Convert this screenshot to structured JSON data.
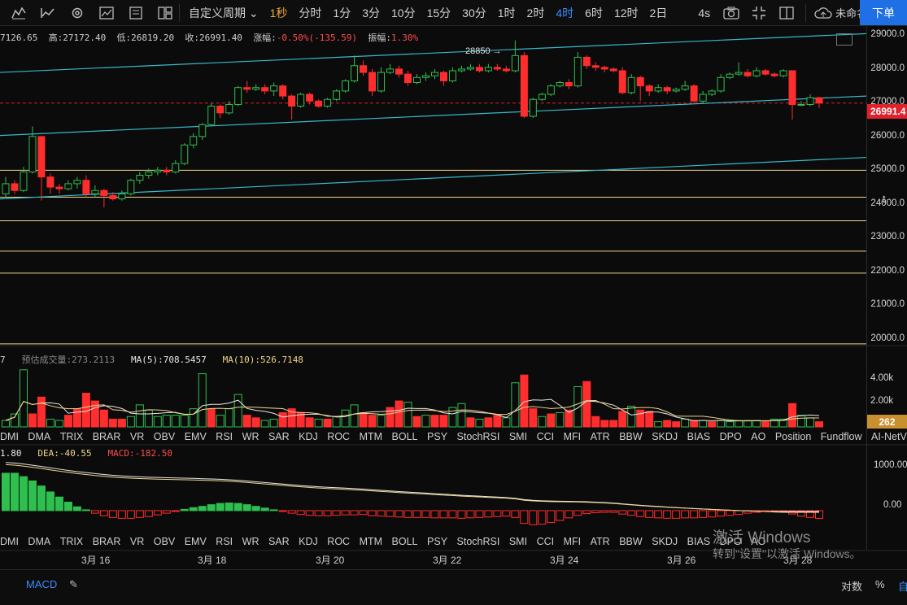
{
  "toolbar": {
    "period_label": "自定义周期",
    "intervals": [
      {
        "label": "1秒",
        "active": true
      },
      {
        "label": "分时"
      },
      {
        "label": "1分"
      },
      {
        "label": "3分"
      },
      {
        "label": "10分"
      },
      {
        "label": "15分"
      },
      {
        "label": "30分"
      },
      {
        "label": "1时"
      },
      {
        "label": "2时"
      },
      {
        "label": "4时",
        "blue": true
      },
      {
        "label": "6时"
      },
      {
        "label": "12时"
      },
      {
        "label": "2日"
      }
    ],
    "refresh": "4s",
    "cloud_name": "未命名",
    "order_button": "下单"
  },
  "info": {
    "open": "7126.65",
    "high_label": "高:",
    "high": "27172.40",
    "low_label": "低:",
    "low": "26819.20",
    "close_label": "收:",
    "close": "26991.40",
    "change_label": "涨幅:",
    "change": "-0.50%(-135.59)",
    "amp_label": "振幅:",
    "amp": "1.30%"
  },
  "annotation_high": "28850",
  "price_axis": [
    "29000.0",
    "28000.0",
    "27000.0",
    "26000.0",
    "25000.0",
    "24000.0",
    "23000.0",
    "22000.0",
    "21000.0",
    "20000.0"
  ],
  "current_price": "26991.4",
  "volume": {
    "left_value": "7",
    "est_label": "预估成交量:",
    "est_value": "273.2113",
    "ma5_label": "MA(5):",
    "ma5_value": "708.5457",
    "ma10_label": "MA(10):",
    "ma10_value": "526.7148",
    "axis": [
      "4.00k",
      "2.00k"
    ],
    "current": "262"
  },
  "indicators": [
    "DMI",
    "DMA",
    "TRIX",
    "BRAR",
    "VR",
    "OBV",
    "EMV",
    "RSI",
    "WR",
    "SAR",
    "KDJ",
    "ROC",
    "MTM",
    "BOLL",
    "PSY",
    "StochRSI",
    "SMI",
    "CCI",
    "MFI",
    "ATR",
    "BBW",
    "SKDJ",
    "BIAS",
    "DPO",
    "AO",
    "Position",
    "Fundflow",
    "AI-NetVOL"
  ],
  "macd": {
    "dif": "1.80",
    "dea_label": "DEA:",
    "dea": "-40.55",
    "macd_label": "MACD:",
    "macd": "-182.50",
    "axis": [
      "1000.00",
      "0.00"
    ]
  },
  "dates": [
    "3月 16",
    "3月 18",
    "3月 20",
    "3月 22",
    "3月 24",
    "3月 26",
    "3月 28"
  ],
  "bottom": {
    "macd_tab": "MACD",
    "log_label": "对数",
    "pct_label": "%",
    "auto_label": "自"
  },
  "watermark": {
    "line1": "激活 Windows",
    "line2": "转到\"设置\"以激活 Windows。"
  },
  "colors": {
    "up": "#2fbf4f",
    "down": "#ff2d2d",
    "channel": "#38b8c8",
    "level": "#f1d58c",
    "accent": "#f2a93b",
    "order": "#1f6fe5"
  },
  "chart_data": {
    "type": "candlestick",
    "ylim": [
      19800,
      29300
    ],
    "levels": [
      25000,
      24200,
      23500,
      22600,
      21950,
      19850
    ],
    "channel_lines": [
      {
        "from": [
          0,
          27900
        ],
        "to": [
          1065,
          29050
        ]
      },
      {
        "from": [
          0,
          26030
        ],
        "to": [
          1065,
          27200
        ]
      },
      {
        "from": [
          0,
          24150
        ],
        "to": [
          1065,
          25380
        ]
      }
    ],
    "candles": [
      [
        24300,
        24600,
        24200,
        24800
      ],
      [
        24600,
        24400,
        24300,
        24700
      ],
      [
        24400,
        24950,
        24350,
        25100
      ],
      [
        24950,
        26000,
        24900,
        26300
      ],
      [
        26000,
        24800,
        24100,
        25900
      ],
      [
        24800,
        24500,
        24300,
        24900
      ],
      [
        24500,
        24450,
        24300,
        24600
      ],
      [
        24450,
        24600,
        24400,
        24700
      ],
      [
        24600,
        24700,
        24450,
        24800
      ],
      [
        24700,
        24300,
        24200,
        24850
      ],
      [
        24300,
        24400,
        24200,
        24550
      ],
      [
        24400,
        24250,
        23900,
        24450
      ],
      [
        24250,
        24150,
        24100,
        24350
      ],
      [
        24150,
        24300,
        24100,
        24400
      ],
      [
        24300,
        24700,
        24250,
        24750
      ],
      [
        24700,
        24850,
        24600,
        24950
      ],
      [
        24850,
        24950,
        24750,
        25050
      ],
      [
        24950,
        25000,
        24850,
        25100
      ],
      [
        25000,
        24950,
        24850,
        25100
      ],
      [
        24950,
        25200,
        24900,
        25300
      ],
      [
        25200,
        25750,
        25150,
        25800
      ],
      [
        25750,
        26000,
        25650,
        26100
      ],
      [
        26000,
        26350,
        25900,
        26400
      ],
      [
        26350,
        26900,
        26300,
        27000
      ],
      [
        26900,
        26700,
        26550,
        26950
      ],
      [
        26700,
        26950,
        26650,
        27050
      ],
      [
        26950,
        27450,
        26900,
        27500
      ],
      [
        27450,
        27400,
        27300,
        27650
      ],
      [
        27400,
        27450,
        27350,
        27550
      ],
      [
        27450,
        27350,
        27250,
        27550
      ],
      [
        27350,
        27500,
        27200,
        27600
      ],
      [
        27500,
        27200,
        27100,
        27550
      ],
      [
        27200,
        26900,
        26500,
        27250
      ],
      [
        26900,
        27250,
        26850,
        27300
      ],
      [
        27250,
        27050,
        26950,
        27300
      ],
      [
        27050,
        26900,
        26850,
        27100
      ],
      [
        26900,
        27100,
        26850,
        27150
      ],
      [
        27100,
        27350,
        27050,
        27400
      ],
      [
        27350,
        27650,
        27300,
        27700
      ],
      [
        27650,
        28100,
        27600,
        28400
      ],
      [
        28100,
        27900,
        27800,
        28250
      ],
      [
        27900,
        27350,
        27200,
        28000
      ],
      [
        27350,
        27900,
        27300,
        28050
      ],
      [
        27900,
        28000,
        27850,
        28150
      ],
      [
        28000,
        27850,
        27750,
        28100
      ],
      [
        27850,
        27600,
        27500,
        27950
      ],
      [
        27600,
        27750,
        27550,
        27850
      ],
      [
        27750,
        27800,
        27650,
        27900
      ],
      [
        27800,
        27900,
        27700,
        28000
      ],
      [
        27900,
        27650,
        27500,
        27950
      ],
      [
        27650,
        27950,
        27600,
        28050
      ],
      [
        27950,
        28000,
        27900,
        28100
      ],
      [
        28000,
        28050,
        27950,
        28150
      ],
      [
        28050,
        27950,
        27900,
        28150
      ],
      [
        27950,
        28050,
        27900,
        28150
      ],
      [
        28050,
        28000,
        27950,
        28150
      ],
      [
        28000,
        27950,
        27900,
        28100
      ],
      [
        27950,
        28400,
        27900,
        28850
      ],
      [
        28400,
        26600,
        26550,
        28500
      ],
      [
        26600,
        27100,
        26550,
        27150
      ],
      [
        27100,
        27250,
        27050,
        27300
      ],
      [
        27250,
        27500,
        27200,
        27550
      ],
      [
        27500,
        27600,
        27450,
        27650
      ],
      [
        27600,
        27500,
        27400,
        27700
      ],
      [
        27500,
        28350,
        27450,
        28500
      ],
      [
        28350,
        28100,
        28000,
        28400
      ],
      [
        28100,
        28050,
        27950,
        28200
      ],
      [
        28050,
        28000,
        27900,
        28100
      ],
      [
        28000,
        27950,
        27900,
        28050
      ],
      [
        27950,
        27300,
        27250,
        28050
      ],
      [
        27300,
        27750,
        27250,
        27850
      ],
      [
        27750,
        27500,
        27050,
        27800
      ],
      [
        27500,
        27350,
        27200,
        27550
      ],
      [
        27350,
        27450,
        27300,
        27550
      ],
      [
        27450,
        27350,
        27250,
        27500
      ],
      [
        27350,
        27400,
        27300,
        27450
      ],
      [
        27400,
        27500,
        27350,
        27650
      ],
      [
        27500,
        27050,
        27000,
        27550
      ],
      [
        27050,
        27250,
        27000,
        27350
      ],
      [
        27250,
        27350,
        27200,
        27400
      ],
      [
        27350,
        27750,
        27300,
        27850
      ],
      [
        27750,
        27850,
        27700,
        27900
      ],
      [
        27850,
        27900,
        27800,
        28200
      ],
      [
        27900,
        27800,
        27750,
        28000
      ],
      [
        27800,
        27950,
        27750,
        28050
      ],
      [
        27950,
        27850,
        27800,
        28000
      ],
      [
        27850,
        27800,
        27750,
        27900
      ],
      [
        27800,
        27950,
        27750,
        28000
      ],
      [
        27950,
        26950,
        26500,
        27950
      ],
      [
        26950,
        26950,
        26900,
        27050
      ],
      [
        26950,
        27150,
        26900,
        27250
      ],
      [
        27150,
        26990,
        26850,
        27172
      ]
    ],
    "volumes": [
      [
        0.5,
        1
      ],
      [
        1.0,
        1
      ],
      [
        4.4,
        1
      ],
      [
        1.0,
        0
      ],
      [
        2.3,
        0
      ],
      [
        0.6,
        1
      ],
      [
        0.5,
        1
      ],
      [
        0.9,
        0
      ],
      [
        1.4,
        0
      ],
      [
        2.6,
        0
      ],
      [
        2.0,
        0
      ],
      [
        1.3,
        0
      ],
      [
        0.6,
        0
      ],
      [
        0.6,
        0
      ],
      [
        0.8,
        1
      ],
      [
        1.7,
        1
      ],
      [
        1.3,
        1
      ],
      [
        0.8,
        1
      ],
      [
        0.9,
        1
      ],
      [
        0.9,
        1
      ],
      [
        0.9,
        1
      ],
      [
        1.4,
        1
      ],
      [
        4.1,
        1
      ],
      [
        1.4,
        0
      ],
      [
        0.9,
        1
      ],
      [
        1.4,
        1
      ],
      [
        2.5,
        1
      ],
      [
        0.9,
        0
      ],
      [
        0.7,
        0
      ],
      [
        0.5,
        1
      ],
      [
        0.6,
        1
      ],
      [
        1.1,
        0
      ],
      [
        1.4,
        0
      ],
      [
        1.1,
        0
      ],
      [
        0.7,
        0
      ],
      [
        0.6,
        1
      ],
      [
        0.6,
        0
      ],
      [
        0.8,
        1
      ],
      [
        1.3,
        1
      ],
      [
        1.7,
        1
      ],
      [
        1.1,
        0
      ],
      [
        0.9,
        0
      ],
      [
        0.9,
        1
      ],
      [
        1.5,
        0
      ],
      [
        2.0,
        0
      ],
      [
        1.9,
        1
      ],
      [
        0.8,
        0
      ],
      [
        0.9,
        1
      ],
      [
        0.9,
        0
      ],
      [
        0.9,
        0
      ],
      [
        1.5,
        1
      ],
      [
        1.8,
        1
      ],
      [
        0.7,
        0
      ],
      [
        0.6,
        1
      ],
      [
        0.7,
        0
      ],
      [
        0.9,
        0
      ],
      [
        0.7,
        1
      ],
      [
        3.4,
        1
      ],
      [
        4.0,
        0
      ],
      [
        1.4,
        0
      ],
      [
        0.8,
        1
      ],
      [
        1.0,
        0
      ],
      [
        1.1,
        1
      ],
      [
        1.3,
        0
      ],
      [
        3.1,
        1
      ],
      [
        3.5,
        0
      ],
      [
        0.8,
        0
      ],
      [
        0.5,
        0
      ],
      [
        0.5,
        0
      ],
      [
        1.2,
        0
      ],
      [
        1.6,
        1
      ],
      [
        1.3,
        0
      ],
      [
        1.2,
        0
      ],
      [
        0.4,
        1
      ],
      [
        0.5,
        0
      ],
      [
        0.4,
        0
      ],
      [
        0.6,
        1
      ],
      [
        0.5,
        0
      ],
      [
        0.5,
        1
      ],
      [
        0.4,
        0
      ],
      [
        0.5,
        1
      ],
      [
        0.4,
        1
      ],
      [
        0.5,
        1
      ],
      [
        0.5,
        1
      ],
      [
        0.5,
        1
      ],
      [
        0.4,
        0
      ],
      [
        0.6,
        1
      ],
      [
        0.6,
        1
      ],
      [
        1.8,
        0
      ],
      [
        0.9,
        1
      ],
      [
        0.7,
        1
      ],
      [
        0.4,
        0
      ]
    ],
    "macd_hist": [
      [
        880
      ],
      [
        880
      ],
      [
        800
      ],
      [
        700
      ],
      [
        580
      ],
      [
        440
      ],
      [
        320
      ],
      [
        200
      ],
      [
        90
      ],
      [
        20
      ],
      [
        -60
      ],
      [
        -120
      ],
      [
        -160
      ],
      [
        -180
      ],
      [
        -180
      ],
      [
        -160
      ],
      [
        -140
      ],
      [
        -100
      ],
      [
        -60
      ],
      [
        -20
      ],
      [
        30
      ],
      [
        70
      ],
      [
        100
      ],
      [
        140
      ],
      [
        170
      ],
      [
        180
      ],
      [
        170
      ],
      [
        140
      ],
      [
        100
      ],
      [
        60
      ],
      [
        20
      ],
      [
        -20
      ],
      [
        -60
      ],
      [
        -90
      ],
      [
        -110
      ],
      [
        -120
      ],
      [
        -120
      ],
      [
        -110
      ],
      [
        -100
      ],
      [
        -100
      ],
      [
        -90
      ],
      [
        -120
      ],
      [
        -130
      ],
      [
        -140
      ],
      [
        -150
      ],
      [
        -160
      ],
      [
        -160
      ],
      [
        -160
      ],
      [
        -170
      ],
      [
        -170
      ],
      [
        -170
      ],
      [
        -180
      ],
      [
        -170
      ],
      [
        -160
      ],
      [
        -150
      ],
      [
        -140
      ],
      [
        -130
      ],
      [
        -160
      ],
      [
        -300
      ],
      [
        -330
      ],
      [
        -320
      ],
      [
        -280
      ],
      [
        -230
      ],
      [
        -170
      ],
      [
        -110
      ],
      [
        -70
      ],
      [
        -50
      ],
      [
        -40
      ],
      [
        -40
      ],
      [
        -80
      ],
      [
        -110
      ],
      [
        -140
      ],
      [
        -160
      ],
      [
        -170
      ],
      [
        -180
      ],
      [
        -180
      ],
      [
        -170
      ],
      [
        -170
      ],
      [
        -160
      ],
      [
        -150
      ],
      [
        -130
      ],
      [
        -110
      ],
      [
        -90
      ],
      [
        -60
      ],
      [
        -40
      ],
      [
        -20
      ],
      [
        -10
      ],
      [
        -10
      ],
      [
        -80
      ],
      [
        -130
      ],
      [
        -160
      ],
      [
        -182.5
      ]
    ],
    "macd_ylim": [
      -900,
      1300
    ]
  }
}
